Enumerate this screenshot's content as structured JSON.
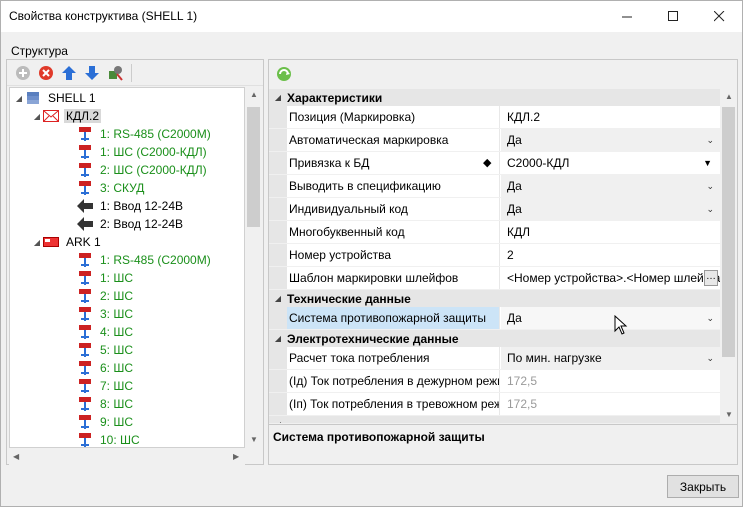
{
  "window": {
    "title": "Свойства конструктива (SHELL 1)"
  },
  "structure_label": "Структура",
  "tree": [
    {
      "label": "SHELL 1",
      "level": 0,
      "icon": "stack-icon",
      "expanded": true,
      "green": false
    },
    {
      "label": "КДЛ.2",
      "level": 1,
      "icon": "envelope-device-icon",
      "expanded": true,
      "green": false,
      "selected": true
    },
    {
      "label": "1: RS-485 (C2000M)",
      "level": 2,
      "icon": "loop-icon",
      "green": true
    },
    {
      "label": "1: ШС  (С2000-КДЛ)",
      "level": 2,
      "icon": "loop-icon",
      "green": true
    },
    {
      "label": "2: ШС  (С2000-КДЛ)",
      "level": 2,
      "icon": "loop-icon",
      "green": true
    },
    {
      "label": "3: СКУД",
      "level": 2,
      "icon": "loop-icon",
      "green": true
    },
    {
      "label": "1: Ввод 12-24В",
      "level": 2,
      "icon": "arrow-left-icon",
      "green": false
    },
    {
      "label": "2: Ввод 12-24В",
      "level": 2,
      "icon": "arrow-left-icon",
      "green": false
    },
    {
      "label": "ARK 1",
      "level": 1,
      "icon": "red-device-icon",
      "expanded": true,
      "green": false
    },
    {
      "label": "1: RS-485 (C2000M)",
      "level": 2,
      "icon": "loop-icon",
      "green": true
    },
    {
      "label": "1: ШС",
      "level": 2,
      "icon": "loop-icon",
      "green": true
    },
    {
      "label": "2: ШС",
      "level": 2,
      "icon": "loop-icon",
      "green": true
    },
    {
      "label": "3: ШС",
      "level": 2,
      "icon": "loop-icon",
      "green": true
    },
    {
      "label": "4: ШС",
      "level": 2,
      "icon": "loop-icon",
      "green": true
    },
    {
      "label": "5: ШС",
      "level": 2,
      "icon": "loop-icon",
      "green": true
    },
    {
      "label": "6: ШС",
      "level": 2,
      "icon": "loop-icon",
      "green": true
    },
    {
      "label": "7: ШС",
      "level": 2,
      "icon": "loop-icon",
      "green": true
    },
    {
      "label": "8: ШС",
      "level": 2,
      "icon": "loop-icon",
      "green": true
    },
    {
      "label": "9: ШС",
      "level": 2,
      "icon": "loop-icon",
      "green": true
    },
    {
      "label": "10: ШС",
      "level": 2,
      "icon": "loop-icon",
      "green": true
    }
  ],
  "props": {
    "cat1": "Характеристики",
    "r1": {
      "name": "Позиция (Маркировка)",
      "value": "КДЛ.2"
    },
    "r2": {
      "name": "Автоматическая маркировка",
      "value": "Да"
    },
    "r3": {
      "name": "Привязка к БД",
      "value": "С2000-КДЛ"
    },
    "r4": {
      "name": "Выводить в спецификацию",
      "value": "Да"
    },
    "r5": {
      "name": "Индивидуальный код",
      "value": "Да"
    },
    "r6": {
      "name": "Многобуквенный код",
      "value": "КДЛ"
    },
    "r7": {
      "name": "Номер устройства",
      "value": "2"
    },
    "r8": {
      "name": "Шаблон маркировки шлейфов",
      "value": "<Номер устройства>.<Номер шлейфа>"
    },
    "cat2": "Технические данные",
    "r9": {
      "name": "Система противопожарной защиты",
      "value": "Да"
    },
    "cat3": "Электротехнические данные",
    "r10": {
      "name": "Расчет тока потребления",
      "value": "По мин. нагрузке"
    },
    "r11": {
      "name": "(Iд) Ток потребления в дежурном режи",
      "value": "172,5"
    },
    "r12": {
      "name": "(Iп) Ток потребления в тревожном реж",
      "value": "172,5"
    }
  },
  "description": "Система противопожарной защиты",
  "close_label": "Закрыть"
}
